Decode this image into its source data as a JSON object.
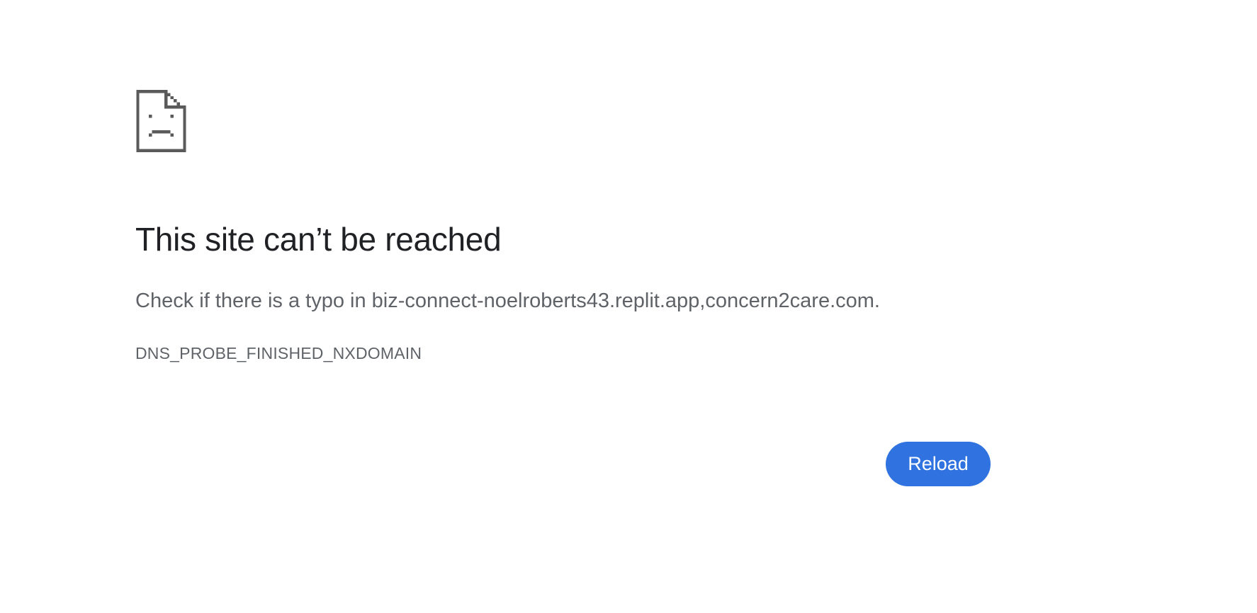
{
  "icon": "sad-page-icon",
  "colors": {
    "title": "#202124",
    "body_text": "#5f6368",
    "icon": "#5a5a5a",
    "button_bg": "#2f72e0",
    "button_text": "#ffffff"
  },
  "error": {
    "title": "This site can’t be reached",
    "message": "Check if there is a typo in biz-connect-noelroberts43.replit.app,concern2care.com.",
    "code": "DNS_PROBE_FINISHED_NXDOMAIN"
  },
  "actions": {
    "reload_label": "Reload"
  }
}
